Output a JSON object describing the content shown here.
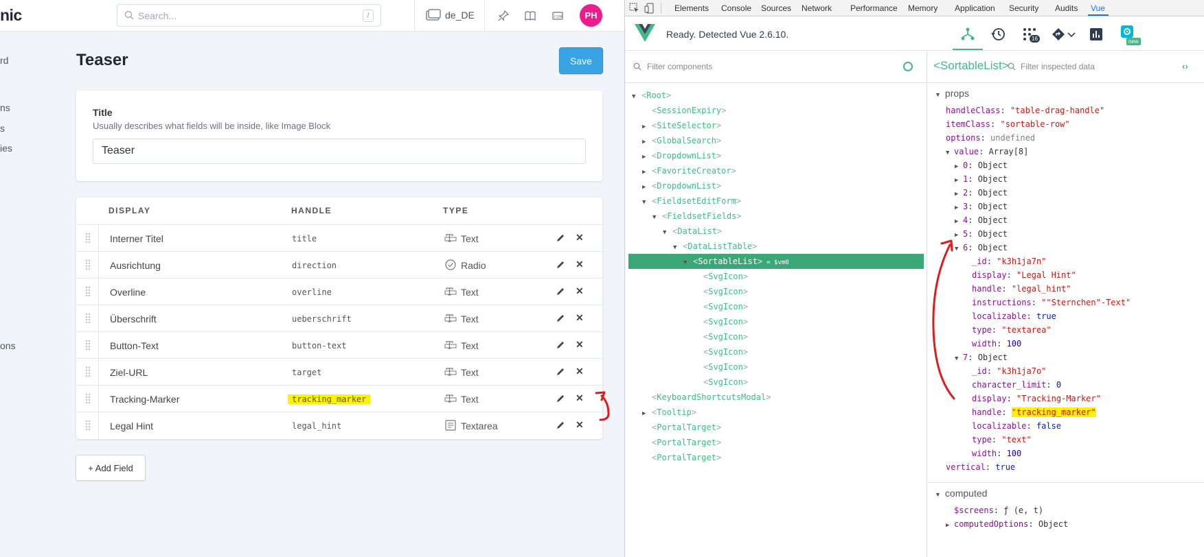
{
  "app": {
    "logo": "nic",
    "search_placeholder": "Search...",
    "search_shortcut": "/",
    "site": "de_DE",
    "avatar_initials": "PH",
    "sidebar_fragments": [
      "rd",
      "ns",
      "s",
      "ies",
      "ons"
    ],
    "page_title": "Teaser",
    "save_label": "Save",
    "title_field": {
      "label": "Title",
      "help": "Usually describes what fields will be inside, like Image Block",
      "value": "Teaser"
    },
    "table": {
      "headers": [
        "DISPLAY",
        "HANDLE",
        "TYPE"
      ],
      "rows": [
        {
          "display": "Interner Titel",
          "handle": "title",
          "type": "Text",
          "icon": "text-field-icon"
        },
        {
          "display": "Ausrichtung",
          "handle": "direction",
          "type": "Radio",
          "icon": "radio-check-icon"
        },
        {
          "display": "Overline",
          "handle": "overline",
          "type": "Text",
          "icon": "text-field-icon"
        },
        {
          "display": "Überschrift",
          "handle": "ueberschrift",
          "type": "Text",
          "icon": "text-field-icon"
        },
        {
          "display": "Button-Text",
          "handle": "button-text",
          "type": "Text",
          "icon": "text-field-icon"
        },
        {
          "display": "Ziel-URL",
          "handle": "target",
          "type": "Text",
          "icon": "text-field-icon"
        },
        {
          "display": "Tracking-Marker",
          "handle": "tracking_marker",
          "type": "Text",
          "icon": "text-field-icon",
          "highlighted": true
        },
        {
          "display": "Legal Hint",
          "handle": "legal_hint",
          "type": "Textarea",
          "icon": "textarea-icon"
        }
      ]
    },
    "add_field_label": "+ Add Field"
  },
  "devtools": {
    "tabs": [
      "Elements",
      "Console",
      "Sources",
      "Network",
      "Performance",
      "Memory",
      "Application",
      "Security",
      "Audits",
      "Vue"
    ],
    "active_tab": "Vue",
    "status": "Ready. Detected Vue 2.6.10.",
    "badge_count": "16",
    "new_badge": "new",
    "filter_components": "Filter components",
    "selected_component": "<SortableList>",
    "filter_inspected": "Filter inspected data",
    "vm_label": "= $vm0",
    "tree": [
      {
        "name": "Root",
        "depth": 0,
        "arrow": "open"
      },
      {
        "name": "SessionExpiry",
        "depth": 1,
        "arrow": "none"
      },
      {
        "name": "SiteSelector",
        "depth": 1,
        "arrow": "closed"
      },
      {
        "name": "GlobalSearch",
        "depth": 1,
        "arrow": "closed"
      },
      {
        "name": "DropdownList",
        "depth": 1,
        "arrow": "closed"
      },
      {
        "name": "FavoriteCreator",
        "depth": 1,
        "arrow": "closed"
      },
      {
        "name": "DropdownList",
        "depth": 1,
        "arrow": "closed"
      },
      {
        "name": "FieldsetEditForm",
        "depth": 1,
        "arrow": "open"
      },
      {
        "name": "FieldsetFields",
        "depth": 2,
        "arrow": "open"
      },
      {
        "name": "DataList",
        "depth": 3,
        "arrow": "open"
      },
      {
        "name": "DataListTable",
        "depth": 4,
        "arrow": "open"
      },
      {
        "name": "SortableList",
        "depth": 5,
        "arrow": "open",
        "selected": true
      },
      {
        "name": "SvgIcon",
        "depth": 6,
        "arrow": "none"
      },
      {
        "name": "SvgIcon",
        "depth": 6,
        "arrow": "none"
      },
      {
        "name": "SvgIcon",
        "depth": 6,
        "arrow": "none"
      },
      {
        "name": "SvgIcon",
        "depth": 6,
        "arrow": "none"
      },
      {
        "name": "SvgIcon",
        "depth": 6,
        "arrow": "none"
      },
      {
        "name": "SvgIcon",
        "depth": 6,
        "arrow": "none"
      },
      {
        "name": "SvgIcon",
        "depth": 6,
        "arrow": "none"
      },
      {
        "name": "SvgIcon",
        "depth": 6,
        "arrow": "none"
      },
      {
        "name": "KeyboardShortcutsModal",
        "depth": 1,
        "arrow": "none"
      },
      {
        "name": "Tooltip",
        "depth": 1,
        "arrow": "closed"
      },
      {
        "name": "PortalTarget",
        "depth": 1,
        "arrow": "none"
      },
      {
        "name": "PortalTarget",
        "depth": 1,
        "arrow": "none"
      },
      {
        "name": "PortalTarget",
        "depth": 1,
        "arrow": "none"
      }
    ],
    "props_label": "props",
    "computed_label": "computed",
    "props": [
      {
        "indent": 0,
        "key": "handleClass",
        "value": "\"table-drag-handle\"",
        "vtype": "s"
      },
      {
        "indent": 0,
        "key": "itemClass",
        "value": "\"sortable-row\"",
        "vtype": "s"
      },
      {
        "indent": 0,
        "key": "options",
        "value": "undefined",
        "vtype": "u"
      },
      {
        "indent": 0,
        "key": "value",
        "value": "Array[8]",
        "vtype": "o",
        "arrow": "open"
      },
      {
        "indent": 1,
        "key": "0",
        "value": "Object",
        "vtype": "o",
        "arrow": "closed"
      },
      {
        "indent": 1,
        "key": "1",
        "value": "Object",
        "vtype": "o",
        "arrow": "closed"
      },
      {
        "indent": 1,
        "key": "2",
        "value": "Object",
        "vtype": "o",
        "arrow": "closed"
      },
      {
        "indent": 1,
        "key": "3",
        "value": "Object",
        "vtype": "o",
        "arrow": "closed"
      },
      {
        "indent": 1,
        "key": "4",
        "value": "Object",
        "vtype": "o",
        "arrow": "closed"
      },
      {
        "indent": 1,
        "key": "5",
        "value": "Object",
        "vtype": "o",
        "arrow": "closed"
      },
      {
        "indent": 1,
        "key": "6",
        "value": "Object",
        "vtype": "o",
        "arrow": "open"
      },
      {
        "indent": 2,
        "key": "_id",
        "value": "\"k3h1ja7n\"",
        "vtype": "s"
      },
      {
        "indent": 2,
        "key": "display",
        "value": "\"Legal Hint\"",
        "vtype": "s"
      },
      {
        "indent": 2,
        "key": "handle",
        "value": "\"legal_hint\"",
        "vtype": "s"
      },
      {
        "indent": 2,
        "key": "instructions",
        "value": "\"\"Sternchen\"-Text\"",
        "vtype": "s"
      },
      {
        "indent": 2,
        "key": "localizable",
        "value": "true",
        "vtype": "kw"
      },
      {
        "indent": 2,
        "key": "type",
        "value": "\"textarea\"",
        "vtype": "s"
      },
      {
        "indent": 2,
        "key": "width",
        "value": "100",
        "vtype": "n"
      },
      {
        "indent": 1,
        "key": "7",
        "value": "Object",
        "vtype": "o",
        "arrow": "open"
      },
      {
        "indent": 2,
        "key": "_id",
        "value": "\"k3h1ja7o\"",
        "vtype": "s"
      },
      {
        "indent": 2,
        "key": "character_limit",
        "value": "0",
        "vtype": "n"
      },
      {
        "indent": 2,
        "key": "display",
        "value": "\"Tracking-Marker\"",
        "vtype": "s"
      },
      {
        "indent": 2,
        "key": "handle",
        "value": "\"tracking_marker\"",
        "vtype": "s",
        "highlighted": true
      },
      {
        "indent": 2,
        "key": "localizable",
        "value": "false",
        "vtype": "kw"
      },
      {
        "indent": 2,
        "key": "type",
        "value": "\"text\"",
        "vtype": "s"
      },
      {
        "indent": 2,
        "key": "width",
        "value": "100",
        "vtype": "n"
      },
      {
        "indent": 0,
        "key": "vertical",
        "value": "true",
        "vtype": "kw"
      }
    ],
    "computed": [
      {
        "key": "$screens",
        "value": "ƒ (e, t)",
        "vtype": "o"
      },
      {
        "key": "computedOptions",
        "value": "Object",
        "vtype": "o",
        "arrow": "closed"
      }
    ]
  },
  "colors": {
    "vue_green": "#42b983",
    "save_blue": "#3aa3e3",
    "avatar_pink": "#ec1c8f",
    "highlight_yellow": "#fff200",
    "annotation_red": "#e0191d"
  }
}
